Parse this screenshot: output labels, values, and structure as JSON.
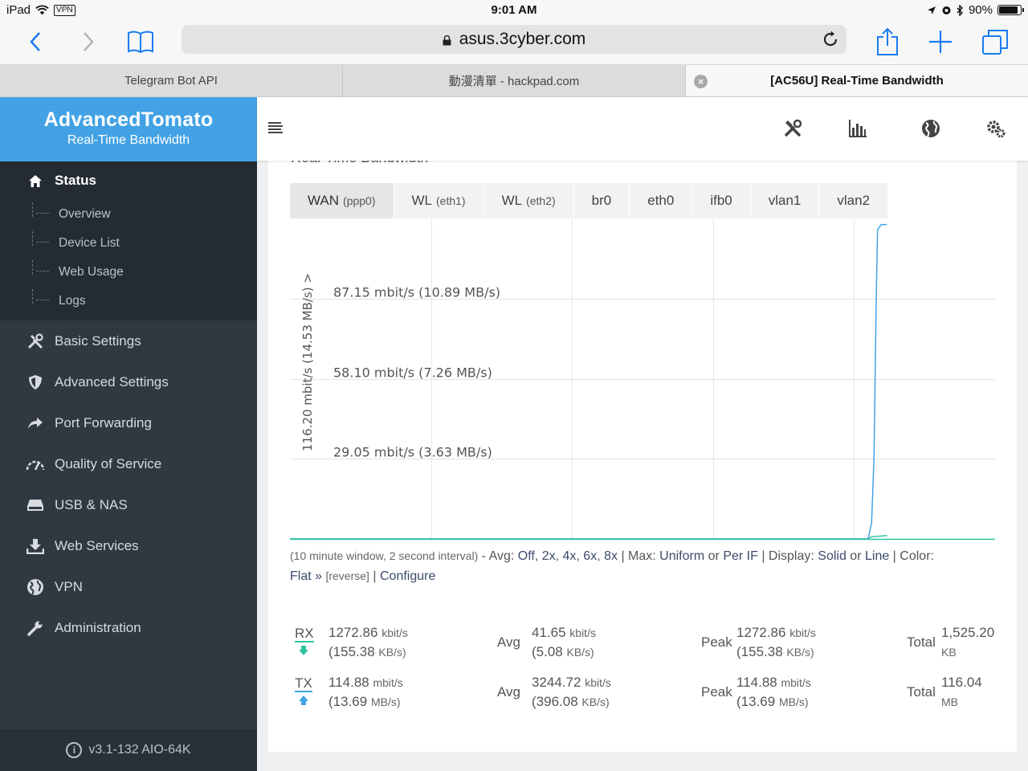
{
  "status_bar": {
    "device": "iPad",
    "vpn": "VPN",
    "time": "9:01 AM",
    "battery": "90%"
  },
  "browser": {
    "url": "asus.3cyber.com",
    "tabs": [
      {
        "title": "Telegram Bot API",
        "active": false
      },
      {
        "title": "動漫清單 - hackpad.com",
        "active": false
      },
      {
        "title": "[AC56U] Real-Time Bandwidth",
        "active": true
      }
    ]
  },
  "sidebar": {
    "brand": "AdvancedTomato",
    "subtitle": "Real-Time Bandwidth",
    "status_label": "Status",
    "status_items": [
      "Overview",
      "Device List",
      "Web Usage",
      "Logs"
    ],
    "items": [
      {
        "label": "Basic Settings",
        "icon": "tools-icon"
      },
      {
        "label": "Advanced Settings",
        "icon": "shield-icon"
      },
      {
        "label": "Port Forwarding",
        "icon": "forward-arrow-icon"
      },
      {
        "label": "Quality of Service",
        "icon": "speedometer-icon"
      },
      {
        "label": "USB & NAS",
        "icon": "drive-icon"
      },
      {
        "label": "Web Services",
        "icon": "download-icon"
      },
      {
        "label": "VPN",
        "icon": "globe-icon"
      },
      {
        "label": "Administration",
        "icon": "wrench-icon"
      }
    ],
    "version": "v3.1-132 AIO-64K"
  },
  "page": {
    "title": "Real-Time Bandwidth"
  },
  "interfaces": [
    {
      "name": "WAN",
      "dev": "(ppp0)",
      "active": true
    },
    {
      "name": "WL",
      "dev": "(eth1)",
      "active": false
    },
    {
      "name": "WL",
      "dev": "(eth2)",
      "active": false
    },
    {
      "name": "br0",
      "dev": "",
      "active": false
    },
    {
      "name": "eth0",
      "dev": "",
      "active": false
    },
    {
      "name": "ifb0",
      "dev": "",
      "active": false
    },
    {
      "name": "vlan1",
      "dev": "",
      "active": false
    },
    {
      "name": "vlan2",
      "dev": "",
      "active": false
    }
  ],
  "chart_data": {
    "type": "line",
    "ylabel": "116.20 mbit/s (14.53 MB/s) >",
    "ylim": [
      0,
      116.2
    ],
    "gridlines": [
      {
        "value": 87.15,
        "label": "87.15 mbit/s (10.89 MB/s)"
      },
      {
        "value": 58.1,
        "label": "58.10 mbit/s (7.26 MB/s)"
      },
      {
        "value": 29.05,
        "label": "29.05 mbit/s (3.63 MB/s)"
      }
    ],
    "xlim": [
      0,
      600
    ],
    "x_unit": "seconds",
    "grid": true,
    "series": [
      {
        "color": "#42a2e5",
        "points": [
          [
            0,
            0
          ],
          [
            488,
            0
          ],
          [
            492,
            0
          ],
          [
            495,
            6
          ],
          [
            497,
            30
          ],
          [
            498,
            60
          ],
          [
            499,
            90
          ],
          [
            500,
            112
          ],
          [
            503,
            114
          ],
          [
            508,
            114
          ]
        ]
      },
      {
        "color": "#2ec4a0",
        "points": [
          [
            0,
            0
          ],
          [
            492,
            0
          ],
          [
            495,
            0.8
          ],
          [
            508,
            1.2
          ]
        ]
      }
    ]
  },
  "options": {
    "window_note": "(10 minute window, 2 second interval)",
    "avg_label": "Avg:",
    "avg_off": "Off",
    "avg_2x": "2x",
    "avg_4x": "4x",
    "avg_6x": "6x",
    "avg_8x": "8x",
    "max_label": "Max:",
    "max_uniform": "Uniform",
    "max_perif": "Per IF",
    "display_label": "Display:",
    "display_solid": "Solid",
    "display_line": "Line",
    "color_label": "Color:",
    "color_flat": "Flat »",
    "color_reverse": "[reverse]",
    "configure": "Configure"
  },
  "stats": {
    "rx": {
      "label": "RX",
      "current": "1272.86",
      "current_unit": "kbit/s",
      "current_b": "(155.38",
      "current_b_unit": "KB/s)",
      "avg_label": "Avg",
      "avg": "41.65",
      "avg_unit": "kbit/s",
      "avg_b": "(5.08",
      "avg_b_unit": "KB/s)",
      "peak_label": "Peak",
      "peak": "1272.86",
      "peak_unit": "kbit/s",
      "peak_b": "(155.38",
      "peak_b_unit": "KB/s)",
      "total_label": "Total",
      "total": "1,525.20",
      "total_unit": "KB"
    },
    "tx": {
      "label": "TX",
      "current": "114.88",
      "current_unit": "mbit/s",
      "current_b": "(13.69",
      "current_b_unit": "MB/s)",
      "avg_label": "Avg",
      "avg": "3244.72",
      "avg_unit": "kbit/s",
      "avg_b": "(396.08",
      "avg_b_unit": "KB/s)",
      "peak_label": "Peak",
      "peak": "114.88",
      "peak_unit": "mbit/s",
      "peak_b": "(13.69",
      "peak_b_unit": "MB/s)",
      "total_label": "Total",
      "total": "116.04",
      "total_unit": "MB"
    }
  },
  "colors": {
    "accent": "#42a2e5",
    "sidebar": "#303841",
    "rx": "#2ec4a0",
    "tx": "#42a2e5",
    "ios_blue": "#1a7cf5"
  }
}
